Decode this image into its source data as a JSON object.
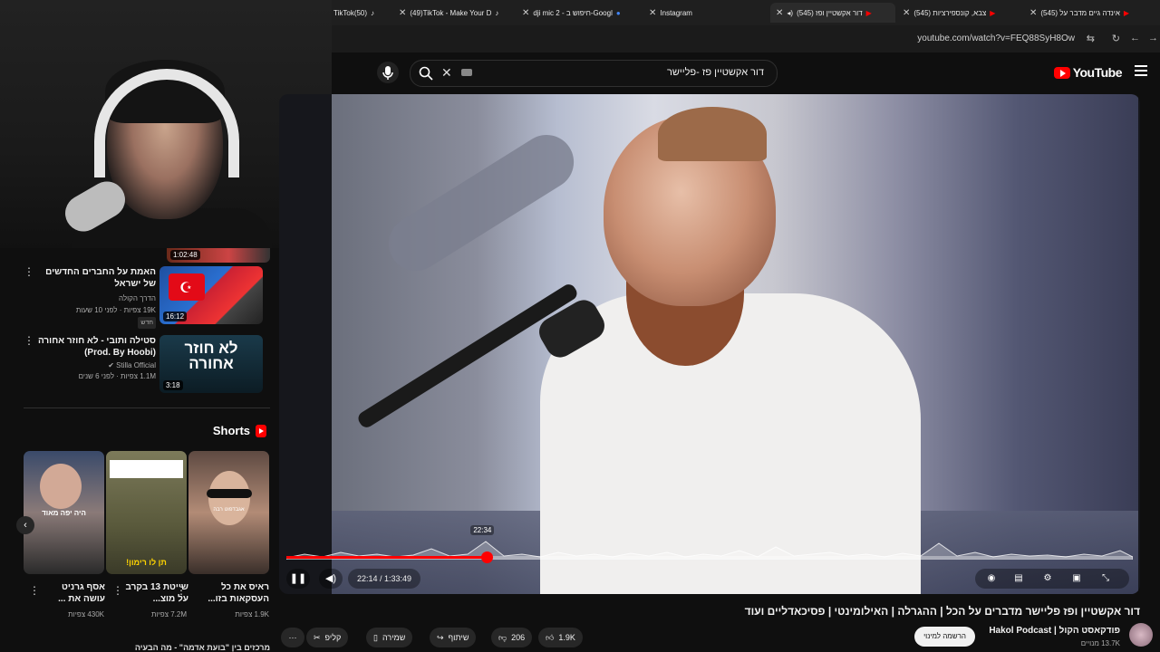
{
  "browser": {
    "tabs": [
      {
        "label": "TikTok(50)"
      },
      {
        "label": "(49)TikTok - Make Your D"
      },
      {
        "label": "dji mic 2 - חיפוש ב-Googl"
      },
      {
        "label": "Instagram"
      },
      {
        "label": "(545) דור אקשטיין ופז"
      },
      {
        "label": "(545) צבא, קונספירציות"
      },
      {
        "label": "(545) אינדה גיים מדבר על"
      }
    ],
    "url": "youtube.com/watch?v=FEQ88SyH8Ow"
  },
  "header": {
    "search_value": "דור אקשטיין פז -פליישר",
    "logo_text": "YouTube"
  },
  "sidebar": {
    "top_partial_duration": "1:02:48",
    "videos": [
      {
        "title": "האמת על החברים החדשים של ישראל",
        "channel": "הדרך הקולה",
        "meta": "19K צפיות · לפני 10 שעות",
        "badge": "חדש",
        "duration": "16:12"
      },
      {
        "title": "סטילה ותובי - לא חוזר אחורה (Prod. By Hoobi)",
        "channel": "Stilla Official",
        "meta": "1.1M צפיות · לפני 6 שנים",
        "duration": "3:18",
        "thumb_text": "לא חוזר אחורה"
      }
    ],
    "shorts_label": "Shorts",
    "shorts": [
      {
        "caption": "ראיס את כל העסקאות בזו...",
        "views": "1.9K צפיות",
        "overlay": "אגבדפוט רבה"
      },
      {
        "caption": "שייטת 13 בקרב על מוצ...",
        "views": "7.2M צפיות",
        "overlay": "תן לו רימון!"
      },
      {
        "caption": "אסף גרניט עושה את ...",
        "views": "430K צפיות",
        "overlay": "היה יפה מאוד"
      }
    ],
    "bottom_partial": "מרכזים בין \"בועת אדמה\" - מה הבעיה"
  },
  "player": {
    "current_time": "22:14",
    "duration": "1:33:49",
    "time_display": "22:14 / 1:33:49",
    "hover_time": "22:34",
    "progress": 0.237
  },
  "video": {
    "title": "דור אקשטיין ופז פליישר מדברים על הכל | ההגרלה | האילומינטי | פסיכאדליים ועוד",
    "channel_name": "פודקאסט הקול | Hakol Podcast",
    "subscribers": "13.7K מנויים",
    "subscribe_label": "הרשמה למינוי",
    "likes": "1.9K",
    "dislikes": "206",
    "share_label": "שיתוף",
    "save_label": "שמירה",
    "clip_label": "קליפ",
    "more_label": "···"
  }
}
